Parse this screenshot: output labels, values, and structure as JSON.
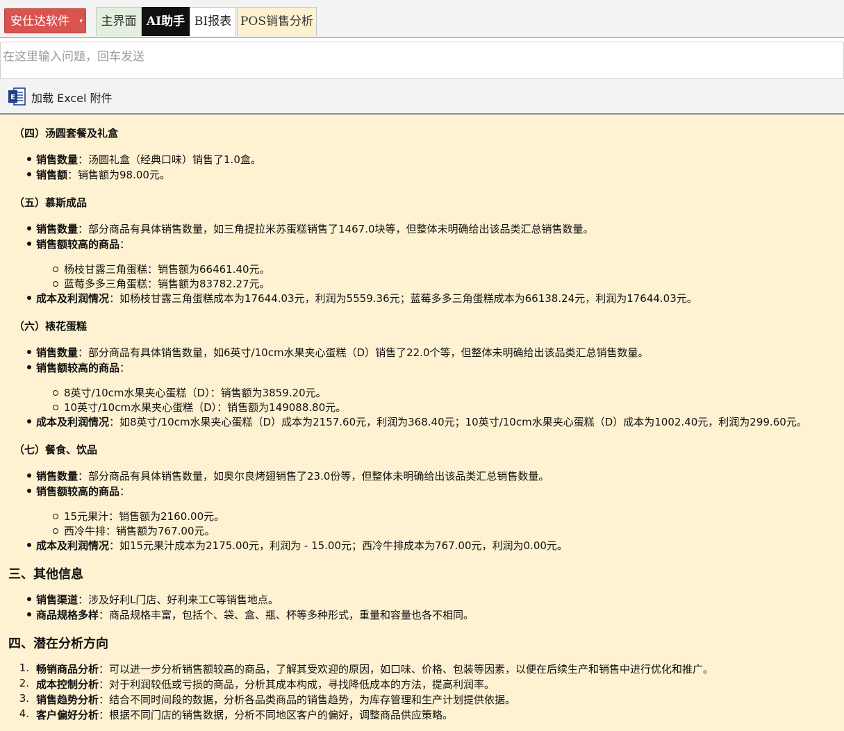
{
  "header": {
    "brand": "安仕达软件",
    "tabs": [
      "主界面",
      "AI助手",
      "BI报表",
      "POS销售分析"
    ]
  },
  "input": {
    "placeholder": "在这里输入问题，回车发送"
  },
  "attach": {
    "label": "加载 Excel 附件"
  },
  "content": {
    "s4": {
      "title": "（四）汤圆套餐及礼盒",
      "b1k": "销售数量",
      "b1v": "：汤圆礼盒（经典口味）销售了1.0盒。",
      "b2k": "销售额",
      "b2v": "：销售额为98.00元。"
    },
    "s5": {
      "title": "（五）慕斯成品",
      "b1k": "销售数量",
      "b1v": "：部分商品有具体销售数量，如三角提拉米苏蛋糕销售了1467.0块等，但整体未明确给出该品类汇总销售数量。",
      "b2k": "销售额较高的商品",
      "b2v": "：",
      "sub1": "杨枝甘露三角蛋糕：销售额为66461.40元。",
      "sub2": "蓝莓多多三角蛋糕：销售额为83782.27元。",
      "b3k": "成本及利润情况",
      "b3v": "：如杨枝甘露三角蛋糕成本为17644.03元，利润为5559.36元；蓝莓多多三角蛋糕成本为66138.24元，利润为17644.03元。"
    },
    "s6": {
      "title": "（六）裱花蛋糕",
      "b1k": "销售数量",
      "b1v": "：部分商品有具体销售数量，如6英寸/10cm水果夹心蛋糕（D）销售了22.0个等，但整体未明确给出该品类汇总销售数量。",
      "b2k": "销售额较高的商品",
      "b2v": "：",
      "sub1": "8英寸/10cm水果夹心蛋糕（D）：销售额为3859.20元。",
      "sub2": "10英寸/10cm水果夹心蛋糕（D）：销售额为149088.80元。",
      "b3k": "成本及利润情况",
      "b3v": "：如8英寸/10cm水果夹心蛋糕（D）成本为2157.60元，利润为368.40元；10英寸/10cm水果夹心蛋糕（D）成本为1002.40元，利润为299.60元。"
    },
    "s7": {
      "title": "（七）餐食、饮品",
      "b1k": "销售数量",
      "b1v": "：部分商品有具体销售数量，如奥尔良烤翅销售了23.0份等，但整体未明确给出该品类汇总销售数量。",
      "b2k": "销售额较高的商品",
      "b2v": "：",
      "sub1": "15元果汁：销售额为2160.00元。",
      "sub2": "西冷牛排：销售额为767.00元。",
      "b3k": "成本及利润情况",
      "b3v": "：如15元果汁成本为2175.00元，利润为 - 15.00元；西冷牛排成本为767.00元，利润为0.00元。"
    },
    "other": {
      "title": "三、其他信息",
      "b1k": "销售渠道",
      "b1v": "：涉及好利L门店、好利来工C等销售地点。",
      "b2k": "商品规格多样",
      "b2v": "：商品规格丰富，包括个、袋、盒、瓶、杯等多种形式，重量和容量也各不相同。"
    },
    "potential": {
      "title": "四、潜在分析方向",
      "i1n": "1.",
      "i1k": "畅销商品分析",
      "i1v": "：可以进一步分析销售额较高的商品，了解其受欢迎的原因，如口味、价格、包装等因素，以便在后续生产和销售中进行优化和推广。",
      "i2n": "2.",
      "i2k": "成本控制分析",
      "i2v": "：对于利润较低或亏损的商品，分析其成本构成，寻找降低成本的方法，提高利润率。",
      "i3n": "3.",
      "i3k": "销售趋势分析",
      "i3v": "：结合不同时间段的数据，分析各品类商品的销售趋势，为库存管理和生产计划提供依据。",
      "i4n": "4.",
      "i4k": "客户偏好分析",
      "i4v": "：根据不同门店的销售数据，分析不同地区客户的偏好，调整商品供应策略。"
    }
  }
}
